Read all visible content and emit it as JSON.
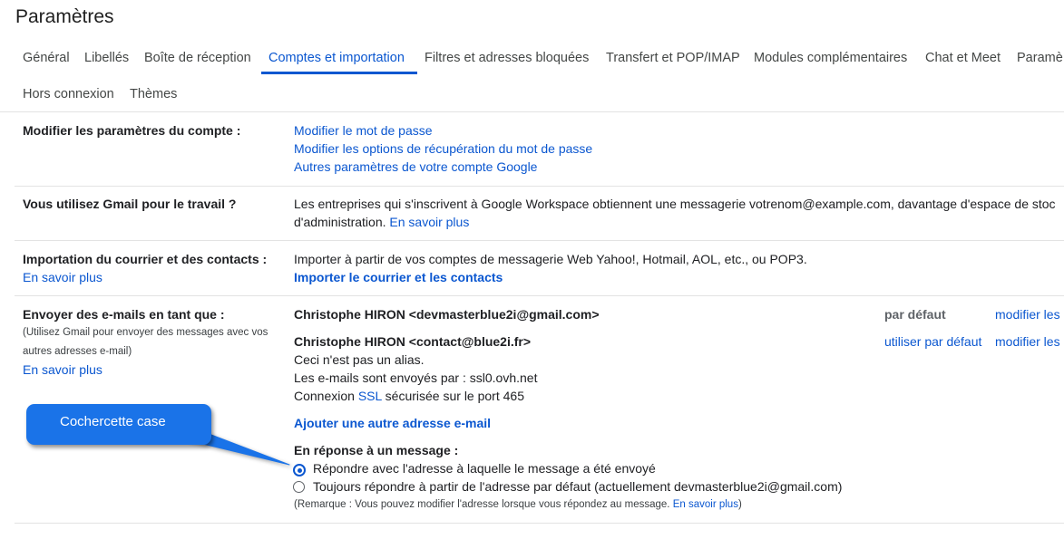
{
  "page": {
    "title": "Paramètres"
  },
  "tabs": [
    {
      "label": "Général"
    },
    {
      "label": "Libellés"
    },
    {
      "label": "Boîte de réception"
    },
    {
      "label": "Comptes et importation",
      "active": true
    },
    {
      "label": "Filtres et adresses bloquées"
    },
    {
      "label": "Transfert et POP/IMAP"
    },
    {
      "label": "Modules complémentaires"
    },
    {
      "label": "Chat et Meet"
    },
    {
      "label": "Paramè"
    },
    {
      "label": "Hors connexion"
    },
    {
      "label": "Thèmes"
    }
  ],
  "account_settings": {
    "label": "Modifier les paramètres du compte :",
    "links": [
      "Modifier le mot de passe",
      "Modifier les options de récupération du mot de passe",
      "Autres paramètres de votre compte Google"
    ]
  },
  "work": {
    "label": "Vous utilisez Gmail pour le travail ?",
    "line1": "Les entreprises qui s'inscrivent à Google Workspace obtiennent une messagerie votrenom@example.com, davantage d'espace de stoc",
    "line2": "d'administration.",
    "learn_more": "En savoir plus"
  },
  "import": {
    "label": "Importation du courrier et des contacts :",
    "learn_more": "En savoir plus",
    "desc": "Importer à partir de vos comptes de messagerie Web Yahoo!, Hotmail, AOL, etc., ou POP3.",
    "action": "Importer le courrier et les contacts"
  },
  "send_as": {
    "label": "Envoyer des e-mails en tant que :",
    "note1": "(Utilisez Gmail pour envoyer des messages avec vos",
    "note2": "autres adresses e-mail)",
    "learn_more": "En savoir plus",
    "identity1": {
      "name": "Christophe HIRON <devmasterblue2i@gmail.com>",
      "status": "par défaut",
      "edit": "modifier les"
    },
    "identity2": {
      "name": "Christophe HIRON <contact@blue2i.fr>",
      "alias": "Ceci n'est pas un alias.",
      "sent_by": "Les e-mails sont envoyés par : ssl0.ovh.net",
      "conn_pre": "Connexion",
      "conn_ssl": "SSL",
      "conn_post": "sécurisée sur le port 465",
      "make_default": "utiliser par défaut",
      "edit": "modifier les"
    },
    "add_address": "Ajouter une autre adresse e-mail",
    "reply_title": "En réponse à un message :",
    "reply_opt1": "Répondre avec l'adresse à laquelle le message a été envoyé",
    "reply_opt2": "Toujours répondre à partir de l'adresse par défaut (actuellement devmasterblue2i@gmail.com)",
    "remark": "(Remarque : Vous pouvez modifier l'adresse lorsque vous répondez au message.",
    "remark_link": "En savoir plus",
    "remark_end": ")"
  },
  "annotation": {
    "text": "Cochercette case"
  },
  "colors": {
    "accent": "#0b57d0",
    "callout": "#1a73e8"
  }
}
